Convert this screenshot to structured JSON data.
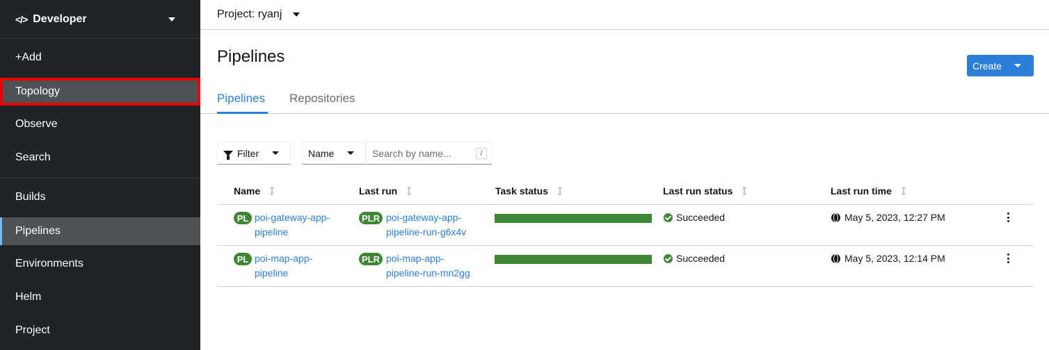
{
  "sidebar": {
    "perspective": "Developer",
    "items": [
      {
        "label": "+Add"
      },
      {
        "label": "Topology"
      },
      {
        "label": "Observe"
      },
      {
        "label": "Search"
      },
      {
        "label": "Builds"
      },
      {
        "label": "Pipelines"
      },
      {
        "label": "Environments"
      },
      {
        "label": "Helm"
      },
      {
        "label": "Project"
      }
    ]
  },
  "topbar": {
    "project": "Project: ryanj"
  },
  "page": {
    "title": "Pipelines",
    "create_label": "Create",
    "tabs": [
      {
        "label": "Pipelines"
      },
      {
        "label": "Repositories"
      }
    ]
  },
  "toolbar": {
    "filter_label": "Filter",
    "select_value": "Name",
    "search_placeholder": "Search by name...",
    "search_shortcut": "/"
  },
  "table": {
    "headers": [
      "Name",
      "Last run",
      "Task status",
      "Last run status",
      "Last run time"
    ],
    "rows": [
      {
        "name_badge": "PL",
        "name_line1": "poi-gateway-app-",
        "name_line2": "pipeline",
        "run_badge": "PLR",
        "run_line1": "poi-gateway-app-",
        "run_line2": "pipeline-run-g6x4v",
        "task_status_fraction": 1.0,
        "status": "Succeeded",
        "time": "May 5, 2023, 12:27 PM"
      },
      {
        "name_badge": "PL",
        "name_line1": "poi-map-app-",
        "name_line2": "pipeline",
        "run_badge": "PLR",
        "run_line1": "poi-map-app-",
        "run_line2": "pipeline-run-mn2gg",
        "task_status_fraction": 1.0,
        "status": "Succeeded",
        "time": "May 5, 2023, 12:14 PM"
      }
    ]
  },
  "colors": {
    "accent": "#2b7fd9",
    "success": "#3e8635",
    "sidebar": "#212427",
    "highlight": "#e00000"
  }
}
